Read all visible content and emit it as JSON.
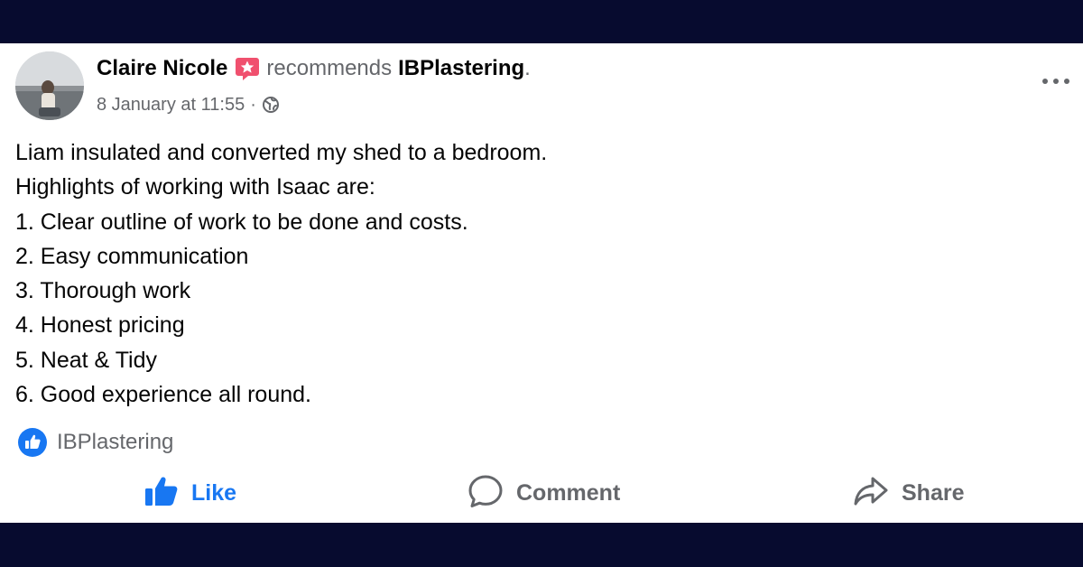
{
  "post": {
    "author": "Claire Nicole",
    "verb": "recommends",
    "page_name": "IBPlastering",
    "trailing_dot": ".",
    "date": "8 January at 11:55",
    "separator": "·",
    "icons": {
      "recommendation_badge": "recommendation-star-icon",
      "audience": "globe-icon",
      "menu": "more-horizontal-icon"
    },
    "body_lines": [
      "Liam insulated and converted my shed to a bedroom.",
      "Highlights of working with Isaac are:",
      "1. Clear outline of work to be done and costs.",
      "2. Easy communication",
      "3. Thorough work",
      "4. Honest pricing",
      "5. Neat & Tidy",
      "6. Good experience all round."
    ],
    "reaction": {
      "icon": "like-reaction-icon",
      "name": "IBPlastering"
    },
    "actions": {
      "like": "Like",
      "comment": "Comment",
      "share": "Share"
    }
  },
  "colors": {
    "frame_background": "#070b2f",
    "card_background": "#ffffff",
    "text_primary": "#050505",
    "text_secondary": "#65676b",
    "accent_blue": "#1877f2",
    "badge_pink": "#f0506e"
  }
}
